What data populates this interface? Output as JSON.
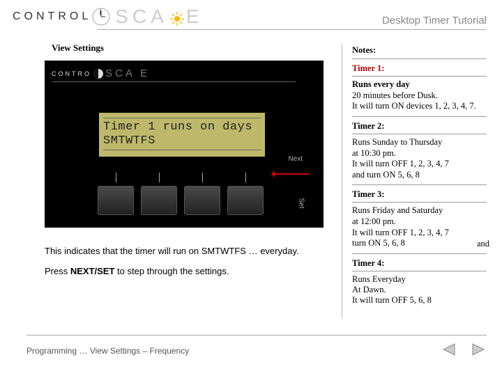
{
  "header": {
    "brand_control": "CONTROL",
    "brand_scape_pre": "SCA",
    "brand_scape_post": "E",
    "tutorial_title": "Desktop Timer Tutorial"
  },
  "section": {
    "title": "View Settings"
  },
  "device": {
    "mini_control": "CONTRO",
    "mini_scape": "SCA  E",
    "lcd_line1": "Timer 1 runs on days",
    "lcd_line2": "SMTWTFS",
    "next_label": "Next",
    "set_label": "Set"
  },
  "caption": {
    "line1": "This indicates that the timer will run on SMTWTFS … everyday.",
    "line2_pre": "Press ",
    "line2_bold": "NEXT/SET",
    "line2_post": " to step through the settings."
  },
  "notes": {
    "heading": "Notes:",
    "timers": [
      {
        "head": "Timer 1:",
        "runs": "Runs every day",
        "body": "20 minutes before Dusk.\nIt will turn ON devices 1, 2, 3, 4, 7."
      },
      {
        "head": "Timer 2:",
        "runs": "",
        "body": "Runs Sunday to Thursday\nat 10:30 pm.\nIt will turn OFF 1, 2, 3, 4, 7\nand turn ON 5, 6, 8"
      },
      {
        "head": "Timer 3:",
        "runs": "",
        "body": "Runs Friday and Saturday\nat 12:00 pm.\nIt will turn OFF 1, 2, 3, 4, 7\nturn ON 5, 6, 8"
      },
      {
        "head": "Timer 4:",
        "runs": "",
        "body": "Runs Everyday\nAt Dawn.\nIt will turn OFF 5, 6, 8"
      }
    ],
    "stray_and": "and"
  },
  "footer": {
    "breadcrumb": "Programming … View Settings – Frequency"
  }
}
